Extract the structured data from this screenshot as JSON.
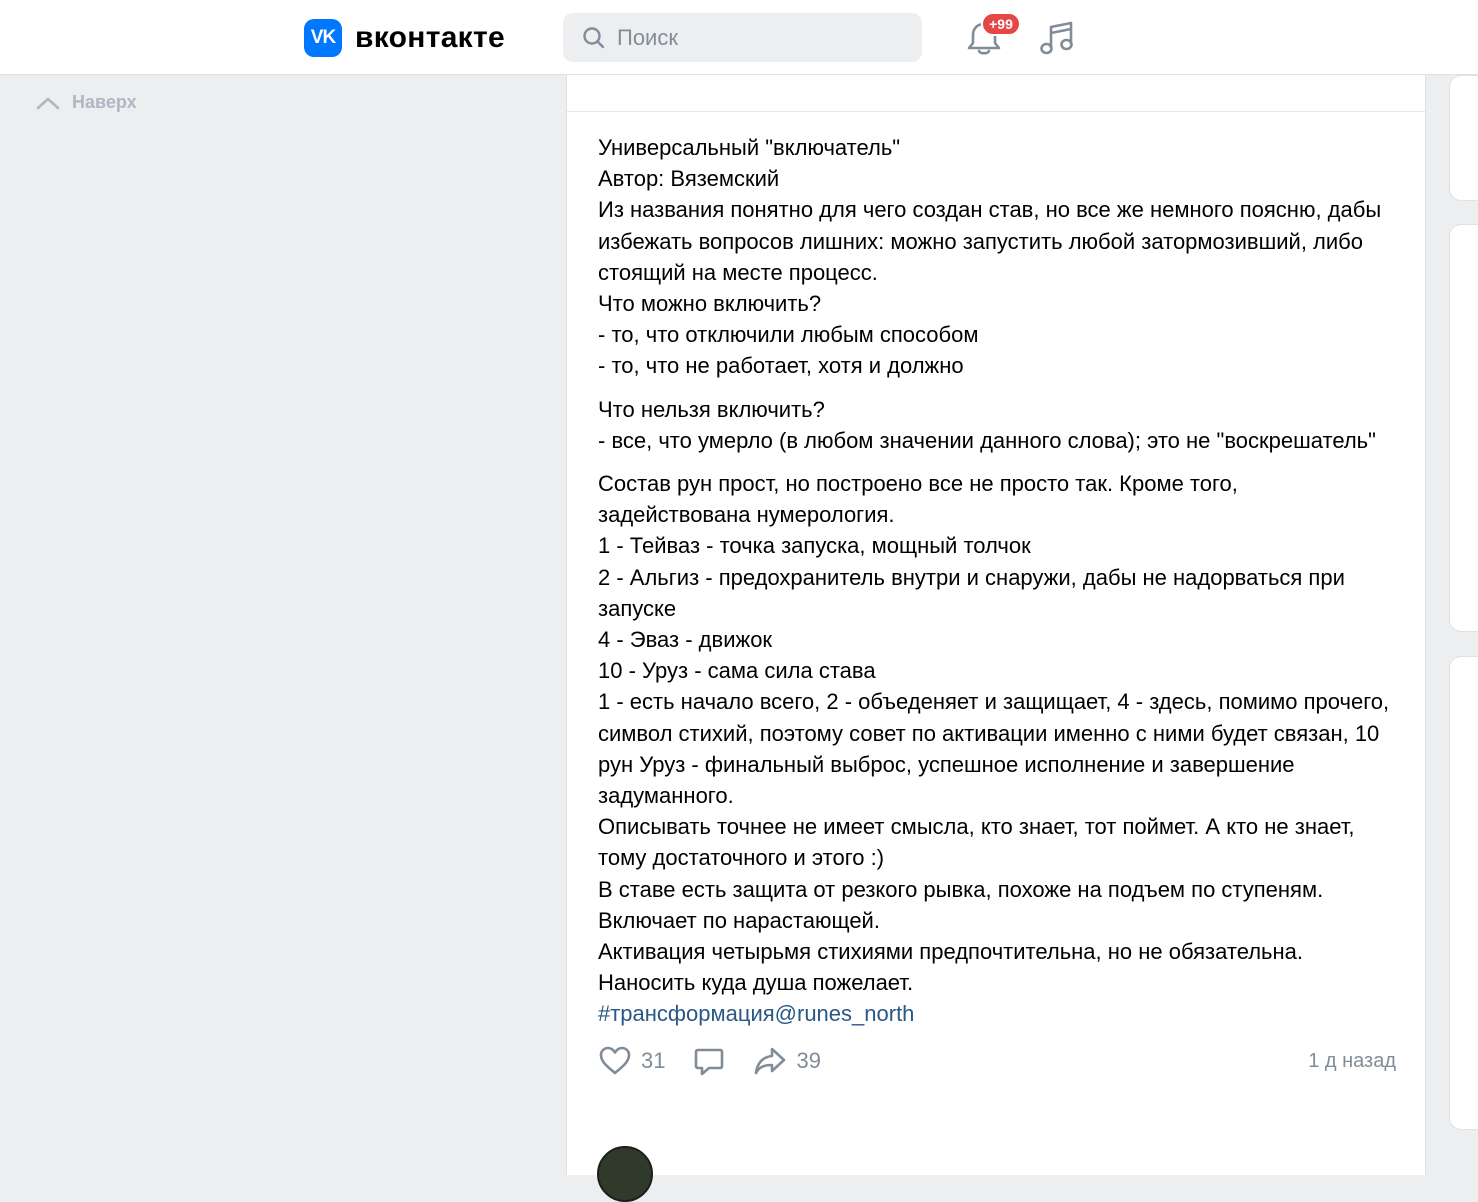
{
  "header": {
    "logo_mark": "VK",
    "logo_text": "вконтакте",
    "search_placeholder": "Поиск",
    "notifications_badge": "+99"
  },
  "sidebar": {
    "up_label": "Наверх"
  },
  "post": {
    "paragraphs": [
      [
        "Универсальный \"включатель\"",
        "Автор: Вяземский",
        "Из названия понятно для чего создан став, но все же немного поясню, дабы",
        "избежать вопросов лишних: можно запустить любой затормозивший, либо",
        "стоящий на месте процесс.",
        "Что можно включить?",
        "- то, что отключили любым способом",
        "- то, что не работает, хотя и должно"
      ],
      [
        "Что нельзя включить?",
        "- все, что умерло (в любом значении данного слова); это не \"воскрешатель\""
      ],
      [
        "Состав рун прост, но построено все не просто так. Кроме того,",
        "задействована нумерология.",
        "1 - Тейваз - точка запуска, мощный толчок",
        "2 - Альгиз - предохранитель внутри и снаружи, дабы не надорваться при",
        "запуске",
        "4 - Эваз - движок",
        "10 - Уруз - сама сила става",
        "1 - есть начало всего, 2 - объеденяет и защищает, 4 - здесь, помимо прочего,",
        "символ стихий, поэтому совет по активации именно с ними будет связан, 10",
        "рун Уруз - финальный выброс, успешное исполнение и завершение",
        "задуманного.",
        "Описывать точнее не имеет смысла, кто знает, тот поймет. А кто не знает,",
        "тому достаточного и этого :)",
        "В ставе есть защита от резкого рывка, похоже на подъем по ступеням.",
        "Включает по нарастающей.",
        "Активация четырьмя стихиями предпочтительна, но не обязательна.",
        "Наносить куда душа пожелает."
      ]
    ],
    "hashtag": "#трансформация@runes_north",
    "likes": "31",
    "shares": "39",
    "time": "1 д назад"
  },
  "colors": {
    "accent": "#0077ff",
    "link": "#2a5885",
    "muted": "#818c99",
    "badge": "#e64646",
    "page_bg": "#edeef0"
  }
}
